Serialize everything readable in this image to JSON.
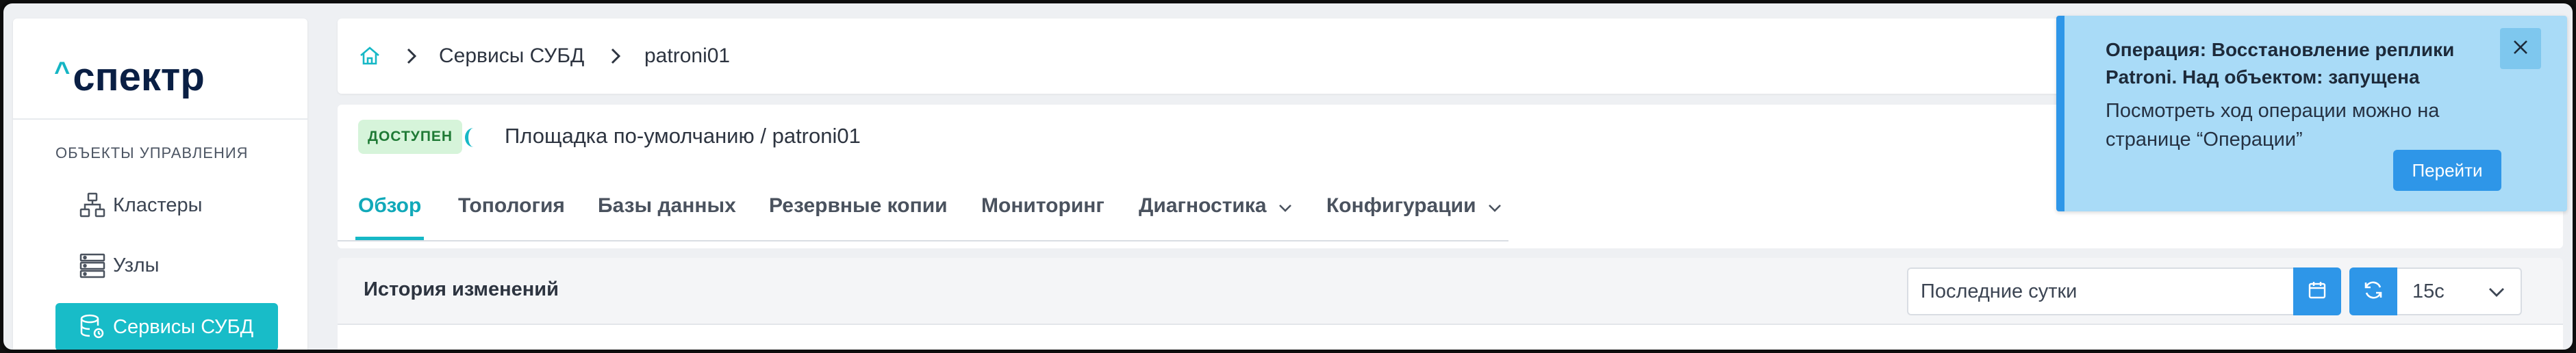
{
  "sidebar": {
    "logo": "спектр",
    "section_title": "ОБЪЕКТЫ УПРАВЛЕНИЯ",
    "items": [
      {
        "label": "Кластеры",
        "icon": "cluster-icon"
      },
      {
        "label": "Узлы",
        "icon": "server-icon"
      },
      {
        "label": "Сервисы СУБД",
        "icon": "database-service-icon",
        "active": true
      }
    ]
  },
  "breadcrumb": {
    "home_icon": "home-icon",
    "items": [
      "Сервисы СУБД",
      "patroni01"
    ]
  },
  "object": {
    "status": "ДОСТУПЕН",
    "location": "Площадка по-умолчанию /  patroni01"
  },
  "tabs": [
    {
      "label": "Обзор",
      "active": true
    },
    {
      "label": "Топология"
    },
    {
      "label": "Базы данных"
    },
    {
      "label": "Резервные копии"
    },
    {
      "label": "Мониторинг"
    },
    {
      "label": "Диагностика",
      "dropdown": true
    },
    {
      "label": "Конфигурации",
      "dropdown": true
    }
  ],
  "history": {
    "title": "История изменений",
    "range_value": "Последние сутки",
    "interval": "15с"
  },
  "notification": {
    "title": "Операция: Восстановление реплики Patroni. Над объектом: запущена",
    "text": "Посмотреть ход операции можно на странице “Операции”",
    "button": "Перейти"
  },
  "colors": {
    "accent": "#16b8c6",
    "primary_button": "#2e96e8",
    "notification_bg": "#a9dbf7",
    "status_badge_bg": "#d6f4da"
  }
}
